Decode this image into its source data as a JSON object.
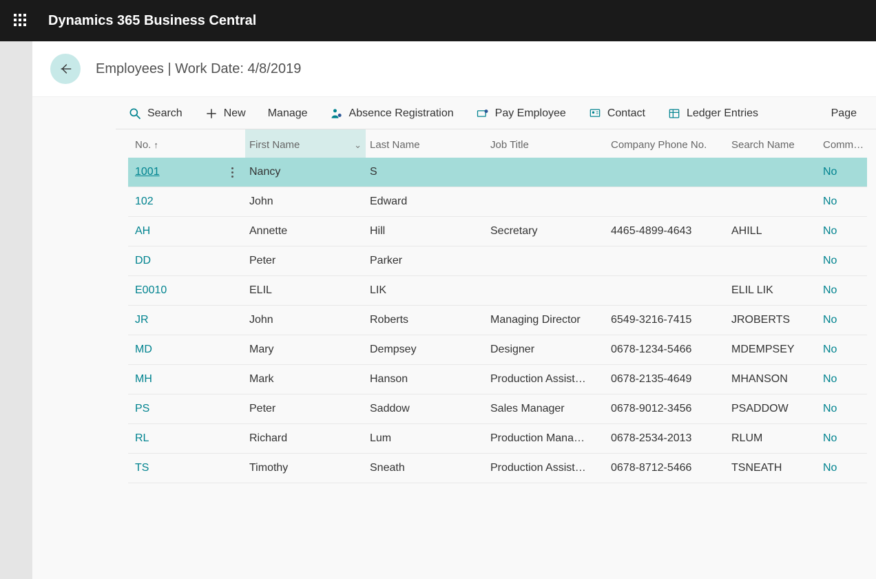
{
  "app": {
    "title": "Dynamics 365 Business Central"
  },
  "header": {
    "breadcrumb": "Employees | Work Date: 4/8/2019"
  },
  "toolbar": {
    "search": "Search",
    "new": "New",
    "manage": "Manage",
    "absence": "Absence Registration",
    "pay": "Pay Employee",
    "contact": "Contact",
    "ledger": "Ledger Entries",
    "page": "Page"
  },
  "columns": {
    "no": "No.",
    "first_name": "First Name",
    "last_name": "Last Name",
    "job_title": "Job Title",
    "phone": "Company Phone No.",
    "search_name": "Search Name",
    "comment": "Comm…"
  },
  "rows": [
    {
      "no": "1001",
      "first_name": "Nancy",
      "last_name": "S",
      "job_title": "",
      "phone": "",
      "search_name": "",
      "comment": "No",
      "selected": true
    },
    {
      "no": "102",
      "first_name": "John",
      "last_name": "Edward",
      "job_title": "",
      "phone": "",
      "search_name": "",
      "comment": "No"
    },
    {
      "no": "AH",
      "first_name": "Annette",
      "last_name": "Hill",
      "job_title": "Secretary",
      "phone": "4465-4899-4643",
      "search_name": "AHILL",
      "comment": "No"
    },
    {
      "no": "DD",
      "first_name": "Peter",
      "last_name": "Parker",
      "job_title": "",
      "phone": "",
      "search_name": "",
      "comment": "No"
    },
    {
      "no": "E0010",
      "first_name": "ELIL",
      "last_name": "LIK",
      "job_title": "",
      "phone": "",
      "search_name": "ELIL LIK",
      "comment": "No"
    },
    {
      "no": "JR",
      "first_name": "John",
      "last_name": "Roberts",
      "job_title": "Managing Director",
      "phone": "6549-3216-7415",
      "search_name": "JROBERTS",
      "comment": "No"
    },
    {
      "no": "MD",
      "first_name": "Mary",
      "last_name": "Dempsey",
      "job_title": "Designer",
      "phone": "0678-1234-5466",
      "search_name": "MDEMPSEY",
      "comment": "No"
    },
    {
      "no": "MH",
      "first_name": "Mark",
      "last_name": "Hanson",
      "job_title": "Production Assist…",
      "phone": "0678-2135-4649",
      "search_name": "MHANSON",
      "comment": "No"
    },
    {
      "no": "PS",
      "first_name": "Peter",
      "last_name": "Saddow",
      "job_title": "Sales Manager",
      "phone": "0678-9012-3456",
      "search_name": "PSADDOW",
      "comment": "No"
    },
    {
      "no": "RL",
      "first_name": "Richard",
      "last_name": "Lum",
      "job_title": "Production Mana…",
      "phone": "0678-2534-2013",
      "search_name": "RLUM",
      "comment": "No"
    },
    {
      "no": "TS",
      "first_name": "Timothy",
      "last_name": "Sneath",
      "job_title": "Production Assist…",
      "phone": "0678-8712-5466",
      "search_name": "TSNEATH",
      "comment": "No"
    }
  ]
}
